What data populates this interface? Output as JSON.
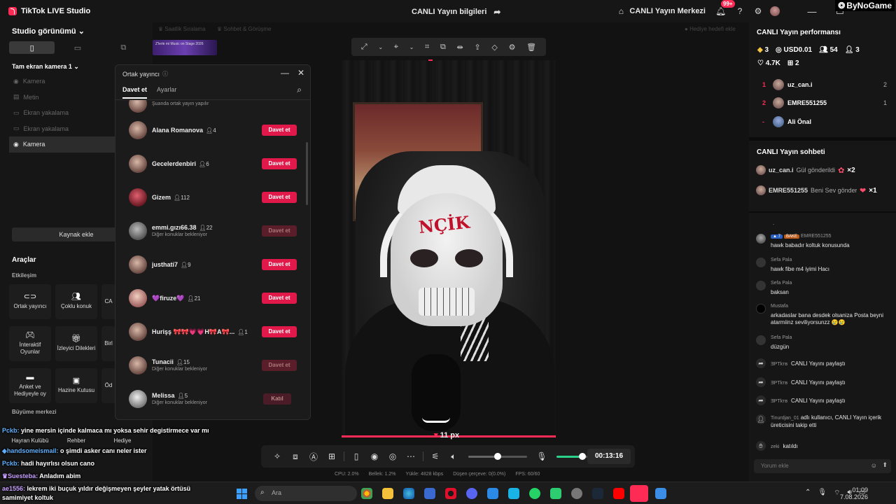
{
  "titlebar": {
    "app_name": "TikTok LIVE Studio",
    "center_title": "CANLI Yayın bilgileri",
    "live_center": "CANLI Yayın Merkezi",
    "notif_count": "99+",
    "watermark": "ByNoGame"
  },
  "left": {
    "studio_view": "Studio görünümü",
    "camera_scene": "Tam ekran kamera 1",
    "sources": [
      "Kamera",
      "Metin",
      "Ekran yakalama",
      "Ekran yakalama",
      "Kamera"
    ],
    "add_source": "Kaynak ekle",
    "tools_title": "Araçlar",
    "engagement": "Etkileşim",
    "tools": [
      {
        "label": "Ortak yayıncı",
        "icon": "link-icon"
      },
      {
        "label": "Çoklu konuk",
        "icon": "users-icon"
      },
      {
        "label": "CA",
        "icon": ""
      },
      {
        "label": "İnteraktif Oyunlar",
        "icon": "gamepad-icon"
      },
      {
        "label": "İzleyici Dilekleri",
        "icon": "gift-icon"
      },
      {
        "label": "Birl",
        "icon": ""
      },
      {
        "label": "Anket ve Hediyeyle oy",
        "icon": "poll-icon"
      },
      {
        "label": "Hazine Kutusu",
        "icon": "chest-icon"
      },
      {
        "label": "Öd",
        "icon": ""
      }
    ],
    "growth": "Büyüme merkezi",
    "growth_tools": [
      "Hayran Kulübü",
      "Rehber",
      "Hediye"
    ]
  },
  "header_strip": {
    "sort": "Saatlik Sıralama",
    "chat": "Sohbet & Görüşme",
    "gift_goal": "Hediye hedefi ekle",
    "thumb_text": "Z'lerle mi Music on Stage 2026"
  },
  "modal": {
    "title": "Ortak yayıncı",
    "tab_invite": "Davet et",
    "tab_settings": "Ayarlar",
    "top_partial": "Şuanda ortak yayın yapılır",
    "rows": [
      {
        "name": "Alana Romanova",
        "count": "4",
        "sub": "",
        "button": "Davet et",
        "state": "active"
      },
      {
        "name": "Gecelerdenbiri",
        "count": "6",
        "sub": "",
        "button": "Davet et",
        "state": "active"
      },
      {
        "name": "Gizem",
        "count": "112",
        "sub": "",
        "button": "Davet et",
        "state": "active"
      },
      {
        "name": "emmi.gızı66.38",
        "count": "22",
        "sub": "Diğer konuklar bekleniyor",
        "button": "Davet et",
        "state": "disabled"
      },
      {
        "name": "justhati7",
        "count": "9",
        "sub": "",
        "button": "Davet et",
        "state": "active"
      },
      {
        "name": "💜firuze💜",
        "count": "21",
        "sub": "",
        "button": "Davet et",
        "state": "active"
      },
      {
        "name": "Hurişş 🎀🎀💗💗H🎀A🎀...",
        "count": "1",
        "sub": "",
        "button": "Davet et",
        "state": "active"
      },
      {
        "name": "Tunacii",
        "count": "15",
        "sub": "Diğer konuklar bekleniyor",
        "button": "Davet et",
        "state": "disabled"
      },
      {
        "name": "Melissa",
        "count": "5",
        "sub": "Diğer konuklar bekleniyor",
        "button": "Katıl",
        "state": "katil"
      }
    ]
  },
  "preview": {
    "mask_text": "NÇİK",
    "px_label": "11 px"
  },
  "controls": {
    "timer": "00:13:16",
    "volume_level": 0.5,
    "mic_level": 0.6
  },
  "stats": {
    "cpu": "CPU: 2.0%",
    "memory": "Bellek: 1.2%",
    "upload": "Yükle: 4828 kbps",
    "dropped": "Düşen çerçeve: 0(0.0%)",
    "fps": "FPS: 60/60"
  },
  "right": {
    "perf_title": "CANLI Yayın performansı",
    "diamonds": "3",
    "usd": "USD0.01",
    "viewers": "54",
    "new_followers": "3",
    "likes": "4.7K",
    "gifters": "2",
    "ranking": [
      {
        "rank": "1",
        "name": "uz_can.i",
        "value": "2"
      },
      {
        "rank": "2",
        "name": "EMRE551255",
        "value": "1"
      },
      {
        "rank": "-",
        "name": "Ali Önal",
        "value": ""
      }
    ],
    "chat_title": "CANLI Yayın sohbeti",
    "gifts": [
      {
        "name": "uz_can.i",
        "text": "Gül gönderildi",
        "mult": "×2"
      },
      {
        "name": "EMRE551255",
        "text": "Beni Sev gönderdi",
        "mult": "×1"
      }
    ],
    "messages": [
      {
        "user": "EMRE551255",
        "badge_level": "7",
        "badge_tag": "BAKE",
        "text": "hawk babadır koltuk konusunda"
      },
      {
        "user": "Sefa Pala",
        "text": "hawk fibe m4 iyimi Hacı"
      },
      {
        "user": "Sefa Pala",
        "text": "baksan"
      },
      {
        "user": "Mustafa",
        "text": "arkadaslar bana desdek olsaniza Posta beyni atarmiinz seviliyorsunzz 😢😢"
      },
      {
        "user": "Sefa Pala",
        "text": "düzgün"
      }
    ],
    "shares": [
      {
        "user": "ƎPTkтв",
        "text": "CANLI Yayını paylaştı"
      },
      {
        "user": "ƎPTkтв",
        "text": "CANLI Yayını paylaştı"
      },
      {
        "user": "ƎPTkтв",
        "text": "CANLI Yayını paylaştı"
      }
    ],
    "follow": {
      "user": "Tinurdjan_01",
      "text": "adlı kullanıcı, CANLI Yayın içerik üreticisini takip etti"
    },
    "join": {
      "user": "zeki",
      "text": "katıldı"
    },
    "comment_placeholder": "Yorum ekle"
  },
  "overlay_chat": [
    {
      "user": "Pckb:",
      "text": "yine mersin içinde kalmaca mı yoksa sehir degistirmece var mı"
    },
    {
      "user": "handsomeismail:",
      "text": "o şimdi asker canı neler ister"
    },
    {
      "user": "Pckb:",
      "text": "hadi hayırlısı olsun cano"
    },
    {
      "user": "Suesteba:",
      "text": "Anladım abim"
    },
    {
      "user": "ae1556:",
      "text": "lekrem iki buçuk yıldır değişmeyen şeyler yatak örtüsü samimiyet koltuk"
    }
  ],
  "taskbar": {
    "search": "Ara",
    "time": "01:09",
    "date": "7.08.2026"
  }
}
